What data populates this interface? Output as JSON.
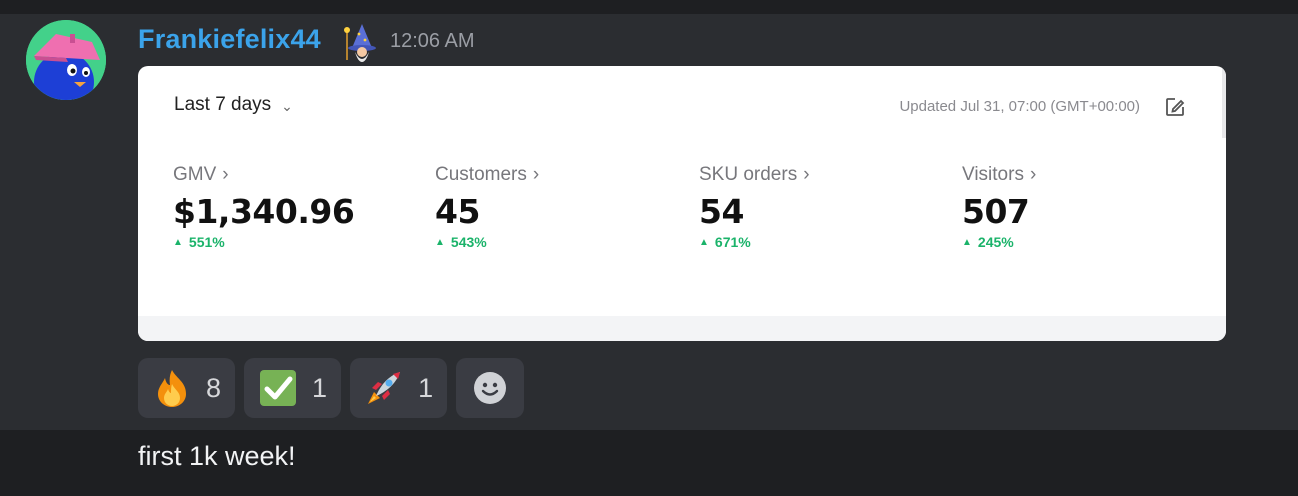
{
  "message": {
    "username": "Frankiefelix44",
    "timestamp": "12:06 AM",
    "role_icon": "wizard-icon"
  },
  "dashboard": {
    "date_range": "Last 7 days",
    "updated": "Updated Jul 31, 07:00 (GMT+00:00)",
    "metrics": [
      {
        "label": "GMV",
        "value": "$1,340.96",
        "change": "551%"
      },
      {
        "label": "Customers",
        "value": "45",
        "change": "543%"
      },
      {
        "label": "SKU orders",
        "value": "54",
        "change": "671%"
      },
      {
        "label": "Visitors",
        "value": "507",
        "change": "245%"
      }
    ],
    "delta_color": "#1bb36a"
  },
  "reactions": [
    {
      "emoji": "fire-icon",
      "count": "8"
    },
    {
      "emoji": "check-mark-icon",
      "count": "1"
    },
    {
      "emoji": "rocket-icon",
      "count": "1"
    }
  ],
  "add_reaction": "smile-icon",
  "next_message": {
    "text": "first 1k week!"
  },
  "colors": {
    "username": "#3ba3ea",
    "background": "#2b2d31",
    "reaction_bg": "#3a3c43"
  }
}
